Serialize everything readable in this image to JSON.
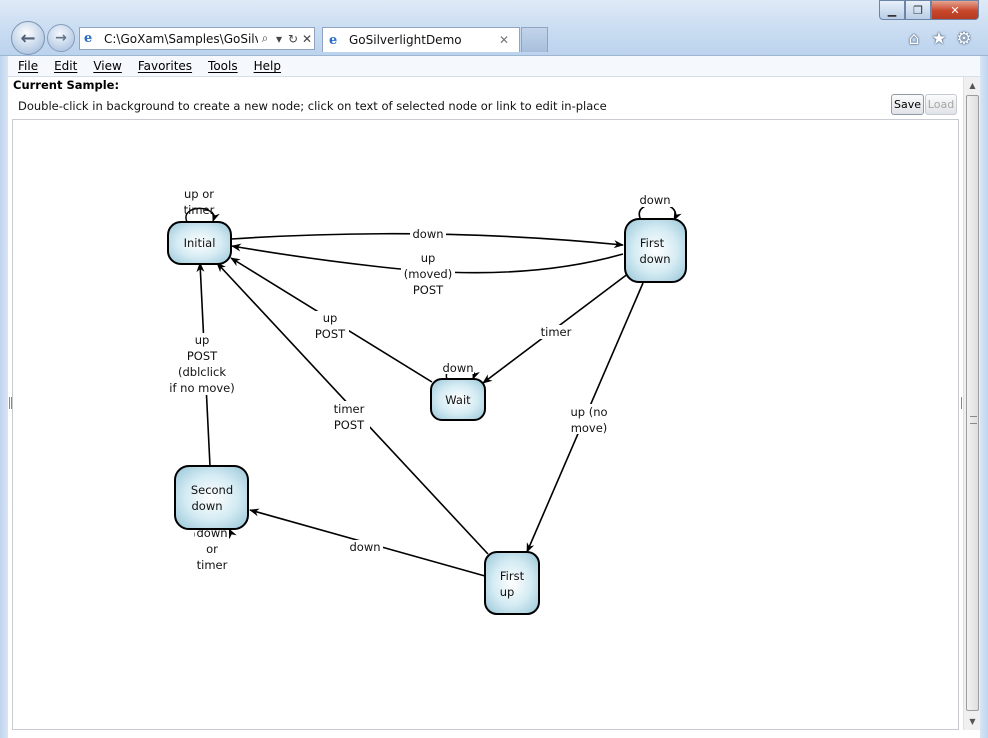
{
  "window": {
    "address": "C:\\GoXam\\Samples\\GoSilv",
    "tab_title": "GoSilverlightDemo",
    "minimize_glyph": "▁",
    "maximize_glyph": "❐",
    "close_glyph": "✕"
  },
  "toolbar": {
    "back_glyph": "←",
    "forward_glyph": "→",
    "search_glyph": "⌕",
    "dropdown_glyph": "▾",
    "refresh_glyph": "↻",
    "stop_glyph": "✕",
    "home_glyph": "⌂",
    "favorites_glyph": "★",
    "tools_glyph": "⚙"
  },
  "menu": [
    "File",
    "Edit",
    "View",
    "Favorites",
    "Tools",
    "Help"
  ],
  "sample": {
    "heading": "Current Sample:",
    "instructions": "Double-click in background to create a new node; click on text of selected node or link to edit in-place",
    "save_label": "Save",
    "load_label": "Load"
  },
  "diagram": {
    "nodes": {
      "initial": [
        "Initial"
      ],
      "first_down": [
        "First",
        "down"
      ],
      "wait": [
        "Wait"
      ],
      "second_down": [
        "Second",
        "down"
      ],
      "first_up": [
        "First",
        "up"
      ]
    },
    "links": {
      "initial_self": [
        "up or",
        "timer"
      ],
      "initial_to_first_down": [
        "down"
      ],
      "first_down_to_initial": [
        "up",
        "(moved)",
        "POST"
      ],
      "first_down_self": [
        "down"
      ],
      "wait_to_initial": [
        "up",
        "POST"
      ],
      "first_down_to_wait": [
        "timer"
      ],
      "wait_self": [
        "down"
      ],
      "second_down_to_initial": [
        "up",
        "POST",
        "(dblclick",
        "if no move)"
      ],
      "first_up_to_initial": [
        "timer",
        "POST"
      ],
      "first_down_to_first_up": [
        "up (no",
        "move)"
      ],
      "first_up_to_second_down": [
        "down"
      ],
      "second_down_self": [
        "down",
        "or",
        "timer"
      ]
    }
  }
}
